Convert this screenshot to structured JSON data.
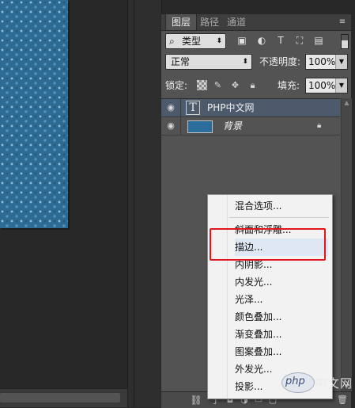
{
  "tabs": [
    "图层",
    "路径",
    "通道"
  ],
  "filter": {
    "label": "类型"
  },
  "blend": {
    "mode": "正常",
    "opacity_label": "不透明度:",
    "opacity_value": "100%"
  },
  "lock": {
    "label": "锁定:",
    "fill_label": "填充:",
    "fill_value": "100%"
  },
  "layers": [
    {
      "name": "PHP中文网",
      "kind": "text",
      "selected": true
    },
    {
      "name": "背景",
      "kind": "image",
      "locked": true
    }
  ],
  "context_menu": {
    "items": [
      "混合选项...",
      "斜面和浮雕...",
      "描边...",
      "内阴影...",
      "内发光...",
      "光泽...",
      "颜色叠加...",
      "渐变叠加...",
      "图案叠加...",
      "外发光...",
      "投影..."
    ],
    "highlighted": "描边..."
  },
  "watermark": {
    "badge": "php",
    "text": "中文网"
  },
  "colors": {
    "panel_bg": "#535353",
    "selected_layer": "#4d5a6c",
    "highlight_box": "#e0161c",
    "canvas_pattern": "#2d6b95"
  }
}
